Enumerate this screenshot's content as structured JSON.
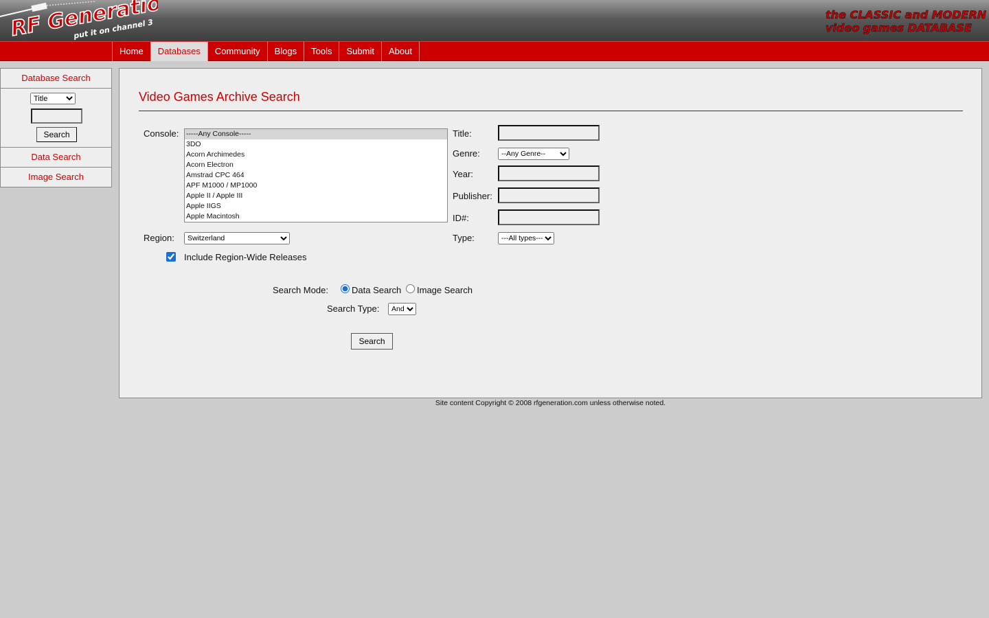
{
  "header": {
    "logo_text": "RF Generation",
    "logo_subtext": "put it on channel 3",
    "tagline_line1": "the CLASSIC and MODERN",
    "tagline_line2": "video games DATABASE"
  },
  "nav": {
    "items": [
      "Home",
      "Databases",
      "Community",
      "Blogs",
      "Tools",
      "Submit",
      "About"
    ],
    "active": "Databases"
  },
  "sidebar": {
    "heading": "Database Search",
    "search_field_selected": "Title",
    "search_input_value": "",
    "search_button": "Search",
    "links": [
      "Data Search",
      "Image Search"
    ]
  },
  "main": {
    "title": "Video Games Archive Search",
    "console_label": "Console:",
    "console_options": [
      "-----Any Console-----",
      "3DO",
      "Acorn Archimedes",
      "Acorn Electron",
      "Amstrad CPC 464",
      "APF M1000 / MP1000",
      "Apple II / Apple III",
      "Apple IIGS",
      "Apple Macintosh"
    ],
    "console_selected": "-----Any Console-----",
    "region_label": "Region:",
    "region_selected": "Switzerland",
    "include_region_wide_label": "Include Region-Wide Releases",
    "include_region_wide_checked": true,
    "title_label": "Title:",
    "title_value": "",
    "genre_label": "Genre:",
    "genre_selected": "--Any Genre--",
    "year_label": "Year:",
    "year_value": "",
    "publisher_label": "Publisher:",
    "publisher_value": "",
    "id_label": "ID#:",
    "id_value": "",
    "type_label": "Type:",
    "type_selected": "---All types---",
    "search_mode_label": "Search Mode:",
    "search_mode_options": [
      "Data Search",
      "Image Search"
    ],
    "search_mode_selected": "Data Search",
    "search_type_label": "Search Type:",
    "search_type_selected": "And",
    "search_button": "Search"
  },
  "footer": {
    "text": "Site content Copyright © 2008 rfgeneration.com unless otherwise noted."
  },
  "colors": {
    "brand_red": "#cc0000",
    "background": "#cccccc",
    "panel": "#eeeeee"
  }
}
